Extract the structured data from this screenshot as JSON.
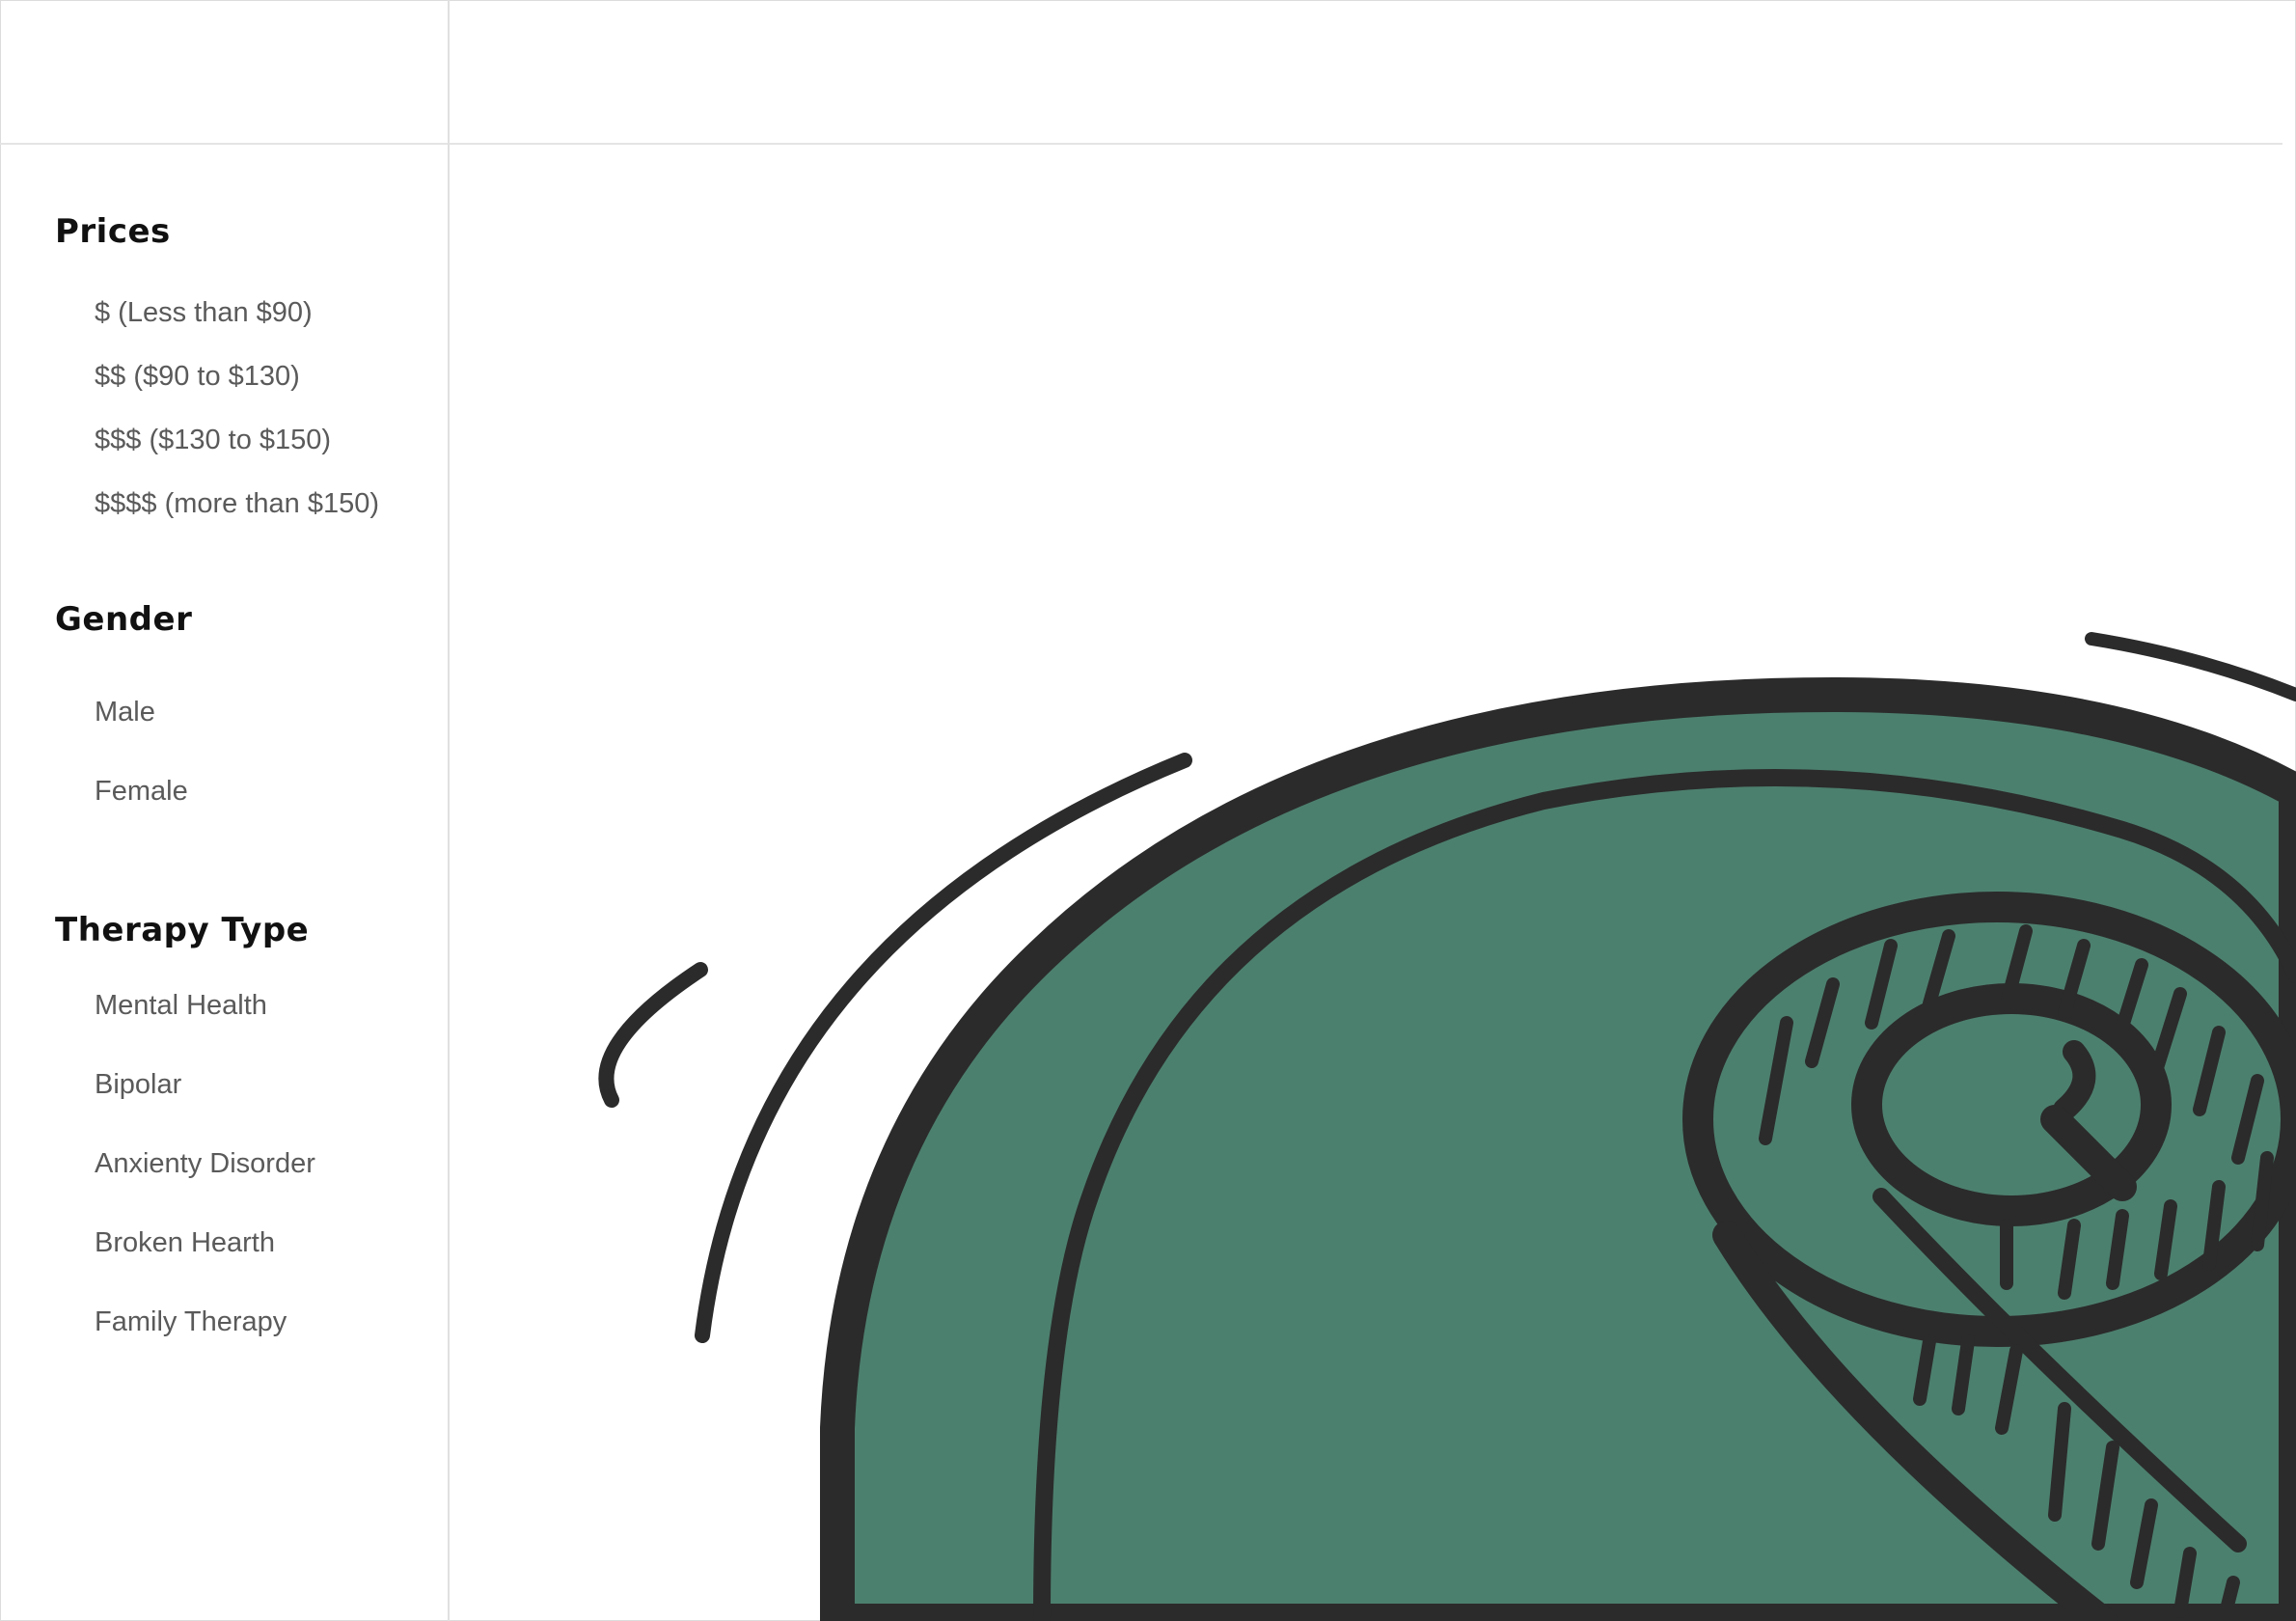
{
  "filters": {
    "prices": {
      "title": "Prices",
      "options": [
        "$ (Less than $90)",
        "$$ ($90 to $130)",
        "$$$ ($130 to $150)",
        "$$$$ (more than $150)"
      ]
    },
    "gender": {
      "title": "Gender",
      "options": [
        "Male",
        "Female"
      ]
    },
    "therapy_type": {
      "title": "Therapy Type",
      "options": [
        "Mental Health",
        "Bipolar",
        "Anxienty Disorder",
        "Broken Hearth",
        "Family Therapy"
      ]
    }
  },
  "colors": {
    "illustration_fill": "#4c806e",
    "illustration_stroke": "#2b2b2b",
    "divider": "#e0e0e0"
  },
  "illustration": {
    "icon": "hand-drawn-ear-illustration"
  }
}
